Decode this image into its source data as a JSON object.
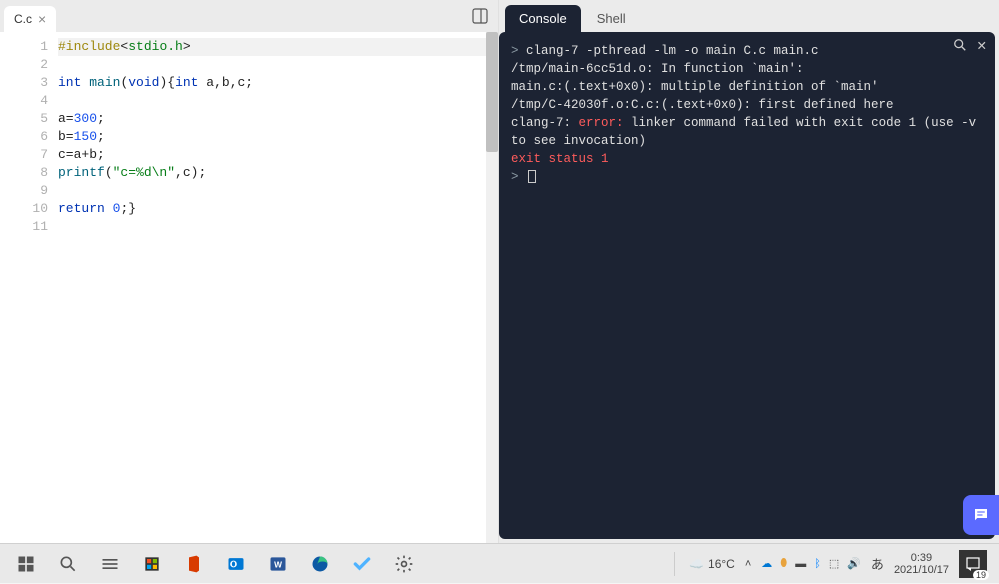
{
  "editor": {
    "tab_label": "C.c",
    "lines": [
      {
        "n": "1",
        "tokens": [
          [
            "preproc",
            "#include"
          ],
          [
            "plain",
            "<"
          ],
          [
            "inc",
            "stdio.h"
          ],
          [
            "plain",
            ">"
          ]
        ],
        "hl": true
      },
      {
        "n": "2",
        "tokens": []
      },
      {
        "n": "3",
        "tokens": [
          [
            "kw",
            "int"
          ],
          [
            "plain",
            " "
          ],
          [
            "fn",
            "main"
          ],
          [
            "plain",
            "("
          ],
          [
            "kw",
            "void"
          ],
          [
            "plain",
            "){"
          ],
          [
            "kw",
            "int"
          ],
          [
            "plain",
            " a,b,c;"
          ]
        ]
      },
      {
        "n": "4",
        "tokens": []
      },
      {
        "n": "5",
        "tokens": [
          [
            "plain",
            "a="
          ],
          [
            "num",
            "300"
          ],
          [
            "plain",
            ";"
          ]
        ]
      },
      {
        "n": "6",
        "tokens": [
          [
            "plain",
            "b="
          ],
          [
            "num",
            "150"
          ],
          [
            "plain",
            ";"
          ]
        ]
      },
      {
        "n": "7",
        "tokens": [
          [
            "plain",
            "c=a+b;"
          ]
        ]
      },
      {
        "n": "8",
        "tokens": [
          [
            "fn",
            "printf"
          ],
          [
            "plain",
            "("
          ],
          [
            "str",
            "\"c=%d\\n\""
          ],
          [
            "plain",
            ",c);"
          ]
        ]
      },
      {
        "n": "9",
        "tokens": []
      },
      {
        "n": "10",
        "tokens": [
          [
            "kw",
            "return"
          ],
          [
            "plain",
            " "
          ],
          [
            "num",
            "0"
          ],
          [
            "plain",
            ";}"
          ]
        ]
      },
      {
        "n": "11",
        "tokens": []
      }
    ]
  },
  "console": {
    "tabs": {
      "console": "Console",
      "shell": "Shell"
    },
    "output": [
      {
        "cls": "",
        "prompt": true,
        "text": "clang-7 -pthread -lm -o main C.c main.c"
      },
      {
        "cls": "",
        "text": "/tmp/main-6cc51d.o: In function `main':"
      },
      {
        "cls": "",
        "text": "main.c:(.text+0x0): multiple definition of `main'"
      },
      {
        "cls": "",
        "text": "/tmp/C-42030f.o:C.c:(.text+0x0): first defined here"
      },
      {
        "cls": "mixed",
        "before": "clang-7: ",
        "err": "error:",
        "after": " linker command failed with exit code 1 (use -v to see invocation)"
      },
      {
        "cls": "c-exit",
        "text": "exit status 1"
      }
    ]
  },
  "taskbar": {
    "weather_temp": "16°C",
    "ime": "あ",
    "time": "0:39",
    "date": "2021/10/17",
    "notif_count": "19"
  }
}
